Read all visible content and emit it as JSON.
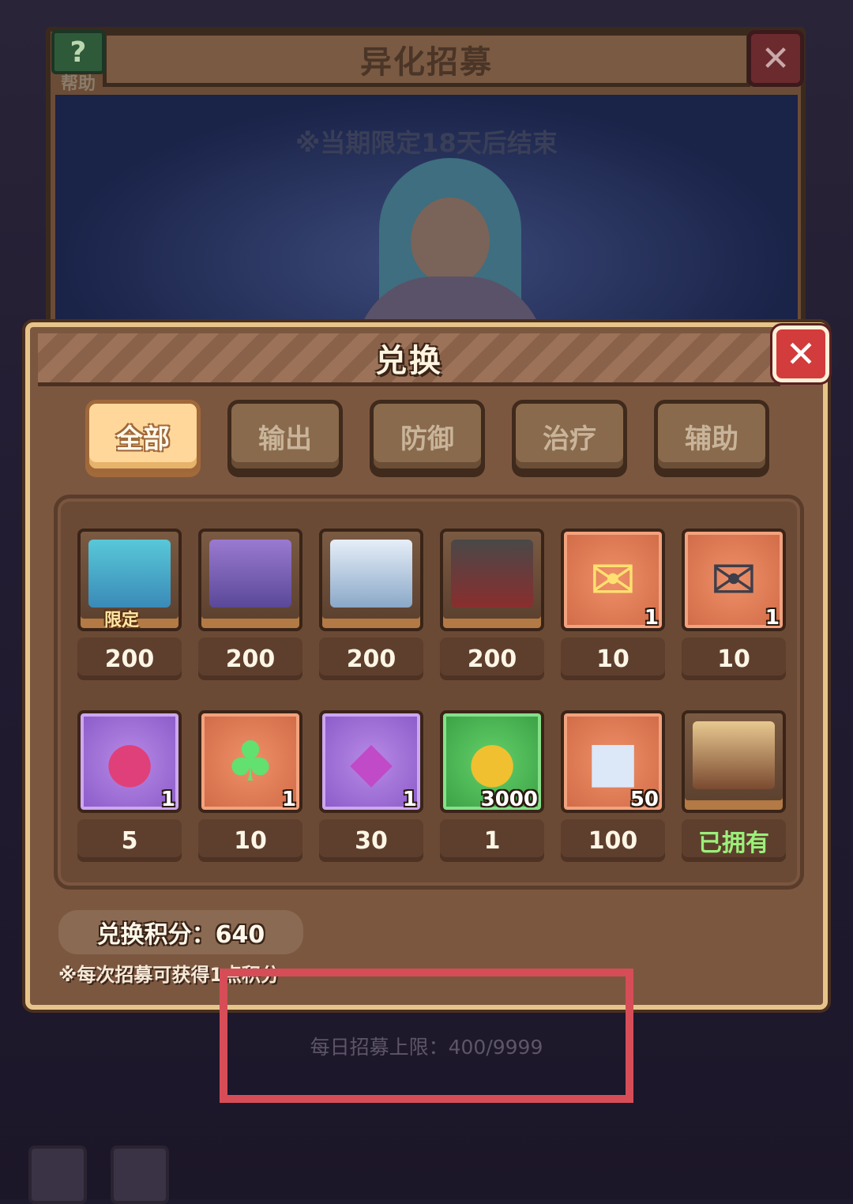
{
  "background": {
    "title": "异化招募",
    "help_label": "帮助",
    "period_text": "※当期限定18天后结束",
    "daily_limit": "每日招募上限：400/9999"
  },
  "modal": {
    "title": "兑换",
    "tabs": [
      {
        "label": "全部",
        "active": true
      },
      {
        "label": "输出"
      },
      {
        "label": "防御"
      },
      {
        "label": "治疗"
      },
      {
        "label": "辅助"
      }
    ],
    "items": [
      {
        "icon": "hero-teal-portrait",
        "tag": "限定",
        "price": "200"
      },
      {
        "icon": "hero-purple-portrait",
        "price": "200"
      },
      {
        "icon": "hero-white-portrait",
        "price": "200"
      },
      {
        "icon": "hero-dark-portrait",
        "price": "200"
      },
      {
        "icon": "gold-letter-icon",
        "quantity": "1",
        "price": "10"
      },
      {
        "icon": "dark-letter-icon",
        "quantity": "1",
        "price": "10"
      },
      {
        "icon": "fruit-icon",
        "quantity": "1",
        "price": "5"
      },
      {
        "icon": "clover-icon",
        "quantity": "1",
        "price": "10"
      },
      {
        "icon": "crystal-icon",
        "quantity": "1",
        "price": "30"
      },
      {
        "icon": "coin-icon",
        "quantity": "3000",
        "price": "1"
      },
      {
        "icon": "puzzle-piece-icon",
        "quantity": "50",
        "price": "100"
      },
      {
        "icon": "hero-blonde-portrait",
        "price": "已拥有",
        "owned": true
      }
    ],
    "points_label": "兑换积分：640",
    "note": "※每次招募可获得1点积分"
  },
  "colors": {
    "accent_active_tab": "#ffd79a",
    "close_red": "#d23c3c",
    "owned_green": "#9af07a",
    "annotation_red": "#d64d58"
  }
}
